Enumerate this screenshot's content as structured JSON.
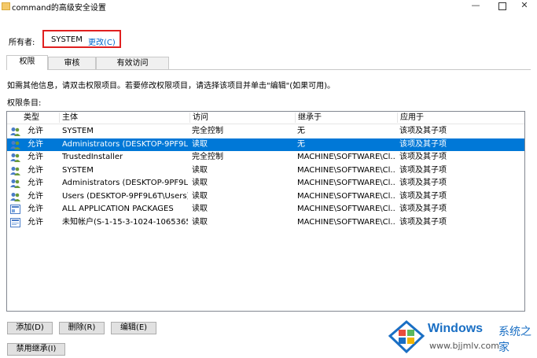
{
  "window": {
    "title": "command的高级安全设置",
    "minimize_glyph": "—",
    "close_glyph": "✕"
  },
  "owner": {
    "label": "所有者:",
    "value": "SYSTEM",
    "change_link": "更改(C)"
  },
  "tabs": [
    {
      "label": "权限",
      "active": true
    },
    {
      "label": "审核",
      "active": false
    },
    {
      "label": "有效访问",
      "active": false
    }
  ],
  "info_text": "如需其他信息，请双击权限项目。若要修改权限项目，请选择该项目并单击\"编辑\"(如果可用)。",
  "entries_label": "权限条目:",
  "table": {
    "columns": [
      "类型",
      "主体",
      "访问",
      "继承于",
      "应用于"
    ],
    "rows": [
      {
        "icon": "users-icon",
        "type": "允许",
        "principal": "SYSTEM",
        "access": "完全控制",
        "inherited": "无",
        "applies": "该项及其子项",
        "selected": false
      },
      {
        "icon": "users-icon",
        "type": "允许",
        "principal": "Administrators (DESKTOP-9PF9L...",
        "access": "读取",
        "inherited": "无",
        "applies": "该项及其子项",
        "selected": true
      },
      {
        "icon": "users-icon",
        "type": "允许",
        "principal": "TrustedInstaller",
        "access": "完全控制",
        "inherited": "MACHINE\\SOFTWARE\\Cl...",
        "applies": "该项及其子项",
        "selected": false
      },
      {
        "icon": "users-icon",
        "type": "允许",
        "principal": "SYSTEM",
        "access": "读取",
        "inherited": "MACHINE\\SOFTWARE\\Cl...",
        "applies": "该项及其子项",
        "selected": false
      },
      {
        "icon": "users-icon",
        "type": "允许",
        "principal": "Administrators (DESKTOP-9PF9L...",
        "access": "读取",
        "inherited": "MACHINE\\SOFTWARE\\Cl...",
        "applies": "该项及其子项",
        "selected": false
      },
      {
        "icon": "users-icon",
        "type": "允许",
        "principal": "Users (DESKTOP-9PF9L6T\\Users)",
        "access": "读取",
        "inherited": "MACHINE\\SOFTWARE\\Cl...",
        "applies": "该项及其子项",
        "selected": false
      },
      {
        "icon": "package-icon",
        "type": "允许",
        "principal": "ALL APPLICATION PACKAGES",
        "access": "读取",
        "inherited": "MACHINE\\SOFTWARE\\Cl...",
        "applies": "该项及其子项",
        "selected": false
      },
      {
        "icon": "unknown-account-icon",
        "type": "允许",
        "principal": "未知帐户(S-1-15-3-1024-1065365...",
        "access": "读取",
        "inherited": "MACHINE\\SOFTWARE\\Cl...",
        "applies": "该项及其子项",
        "selected": false
      }
    ]
  },
  "buttons": {
    "add": "添加(D)",
    "remove": "删除(R)",
    "edit": "编辑(E)",
    "disable_inheritance": "禁用继承(I)"
  },
  "watermark": {
    "brand": "Windows",
    "cn": "系统之家",
    "url": "www.bjjmlv.com"
  },
  "colors": {
    "selection": "#0078d7",
    "link": "#0066cc",
    "highlight_box": "#e02020"
  }
}
